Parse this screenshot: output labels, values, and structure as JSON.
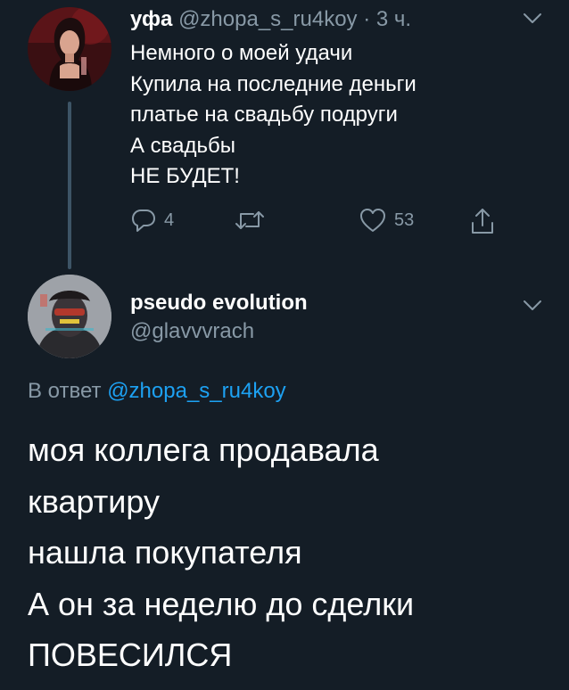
{
  "parent_tweet": {
    "display_name": "уфа",
    "handle": "@zhopa_s_ru4koy",
    "separator": "·",
    "time": "3 ч.",
    "lines": [
      "Немного о моей удачи",
      "Купила на последние деньги",
      "платье на свадьбу подруги",
      "А свадьбы",
      "НЕ БУДЕТ!"
    ],
    "actions": {
      "reply_icon": "reply-icon",
      "reply_count": "4",
      "retweet_icon": "retweet-icon",
      "like_icon": "heart-icon",
      "like_count": "53",
      "share_icon": "share-icon"
    },
    "menu_icon": "chevron-down-icon"
  },
  "reply_tweet": {
    "display_name": "pseudo evolution",
    "handle": "@glavvvrach",
    "menu_icon": "chevron-down-icon",
    "reply_to_label": "В ответ",
    "reply_to_mention": "@zhopa_s_ru4koy",
    "lines": [
      "моя коллега продавала",
      "квартиру",
      "нашла покупателя",
      "А он за неделю до сделки",
      "ПОВЕСИЛСЯ"
    ]
  },
  "colors": {
    "background": "#141d26",
    "text": "#ffffff",
    "secondary": "#8899a6",
    "link": "#1da1f2",
    "thread_line": "#3d5466"
  }
}
